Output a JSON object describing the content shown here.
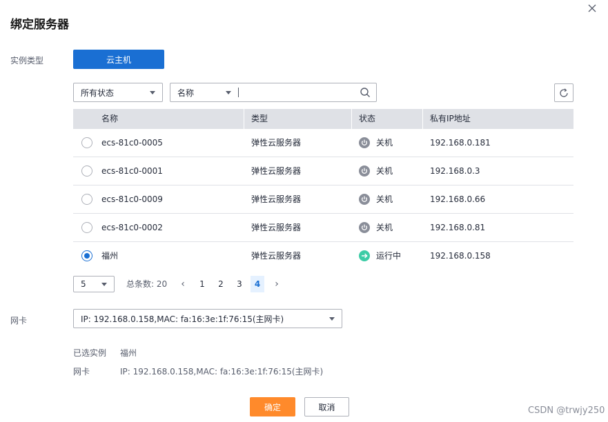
{
  "dialog": {
    "title": "绑定服务器"
  },
  "instance_type": {
    "label": "实例类型",
    "selected_button": "云主机"
  },
  "filters": {
    "status_select": "所有状态",
    "field_select": "名称",
    "search_value": ""
  },
  "table": {
    "headers": [
      "名称",
      "类型",
      "状态",
      "私有IP地址"
    ],
    "rows": [
      {
        "name": "ecs-81c0-0005",
        "type": "弹性云服务器",
        "status": "关机",
        "status_kind": "off",
        "ip": "192.168.0.181",
        "selected": false
      },
      {
        "name": "ecs-81c0-0001",
        "type": "弹性云服务器",
        "status": "关机",
        "status_kind": "off",
        "ip": "192.168.0.3",
        "selected": false
      },
      {
        "name": "ecs-81c0-0009",
        "type": "弹性云服务器",
        "status": "关机",
        "status_kind": "off",
        "ip": "192.168.0.66",
        "selected": false
      },
      {
        "name": "ecs-81c0-0002",
        "type": "弹性云服务器",
        "status": "关机",
        "status_kind": "off",
        "ip": "192.168.0.81",
        "selected": false
      },
      {
        "name": "福州",
        "type": "弹性云服务器",
        "status": "运行中",
        "status_kind": "running",
        "ip": "192.168.0.158",
        "selected": true
      }
    ]
  },
  "pagination": {
    "page_size": "5",
    "total_label": "总条数: 20",
    "pages": [
      "1",
      "2",
      "3",
      "4"
    ],
    "current_page": "4"
  },
  "nic": {
    "label": "网卡",
    "selected_value": "IP: 192.168.0.158,MAC: fa:16:3e:1f:76:15(主网卡)"
  },
  "summary": {
    "instance_label": "已选实例",
    "instance_value": "福州",
    "nic_label": "网卡",
    "nic_value": "IP: 192.168.0.158,MAC: fa:16:3e:1f:76:15(主网卡)"
  },
  "buttons": {
    "ok": "确定",
    "cancel": "取消"
  },
  "watermark": "CSDN @trwjy250",
  "colors": {
    "primary": "#1a6fd3",
    "confirm": "#ff8a2b",
    "status_off": "#8a8e99",
    "status_running": "#3dcca6",
    "header_bg": "#dfe1e6"
  }
}
